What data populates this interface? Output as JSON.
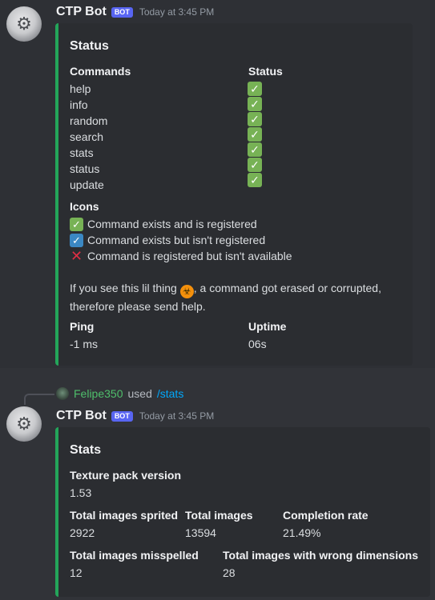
{
  "message1": {
    "author": "CTP Bot",
    "bot_tag": "BOT",
    "timestamp": "Today at 3:45 PM",
    "embed": {
      "title": "Status",
      "commands_header": "Commands",
      "status_header": "Status",
      "commands": [
        "help",
        "info",
        "random",
        "search",
        "stats",
        "status",
        "update"
      ],
      "status_icon": "✓",
      "icons_header": "Icons",
      "icon_legend": [
        {
          "icon": "green-check",
          "text": "Command exists and is registered"
        },
        {
          "icon": "blue-check",
          "text": "Command exists but isn't registered"
        },
        {
          "icon": "red-cross",
          "text": "Command is registered but isn't available"
        }
      ],
      "help_text_before": "If you see this lil thing",
      "help_text_after": ", a command got erased or corrupted,",
      "help_text_line2": "therefore please send help.",
      "ping_label": "Ping",
      "ping_value": "-1 ms",
      "uptime_label": "Uptime",
      "uptime_value": "06s"
    }
  },
  "reply": {
    "user": "Felipe350",
    "used": "used",
    "command": "/stats"
  },
  "message2": {
    "author": "CTP Bot",
    "bot_tag": "BOT",
    "timestamp": "Today at 3:45 PM",
    "embed": {
      "title": "Stats",
      "texture_label": "Texture pack version",
      "texture_value": "1.53",
      "sprited_label": "Total images sprited",
      "sprited_value": "2922",
      "total_label": "Total images",
      "total_value": "13594",
      "completion_label": "Completion rate",
      "completion_value": "21.49%",
      "misspelled_label": "Total images misspelled",
      "misspelled_value": "12",
      "wrongdim_label": "Total images with wrong dimensions",
      "wrongdim_value": "28"
    }
  },
  "colors": {
    "embed_accent": "#23a55a",
    "bot_tag": "#5865f2",
    "reply_user": "#4fbf6b",
    "reply_command": "#00a8fc"
  }
}
